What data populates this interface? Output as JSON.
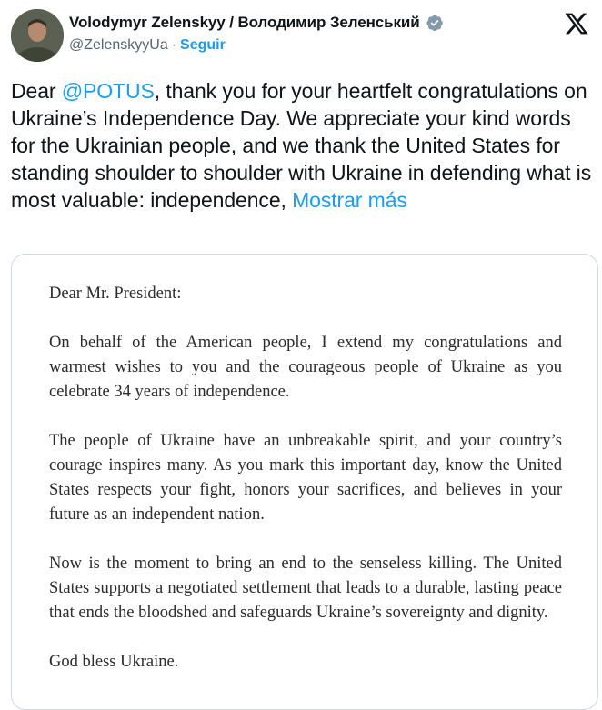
{
  "author": {
    "display_name": "Volodymyr Zelenskyy / Володимир Зеленський",
    "handle": "@ZelenskyyUa",
    "separator": "·",
    "follow_label": "Seguir"
  },
  "tweet": {
    "text_before_mention": "Dear ",
    "mention": "@POTUS",
    "text_after_mention": ", thank you for your heartfelt congratulations on Ukraine’s Independence Day. We appreciate your kind words for the Ukrainian people, and we thank the United States for standing shoulder to shoulder with Ukraine in defending what is most valuable: independence, ",
    "show_more_label": "Mostrar más"
  },
  "letter": {
    "salutation": "Dear Mr. President:",
    "paragraphs": [
      "On behalf of the American people, I extend my congratulations and warmest wishes to you and the courageous people of Ukraine as you celebrate 34 years of independence.",
      "The people of Ukraine have an unbreakable spirit, and your country’s courage inspires many. As you mark this important day, know the United States respects your fight, honors your sacrifices, and believes in your future as an independent nation.",
      "Now is the moment to bring an end to the senseless killing. The United States supports a negotiated settlement that leads to a durable, lasting peace that ends the bloodshed and safeguards Ukraine’s sovereignty and dignity."
    ],
    "closing": "God bless Ukraine."
  },
  "icons": {
    "avatar": "avatar",
    "verified": "verified-badge-icon",
    "logo": "x-logo-icon"
  },
  "colors": {
    "link": "#1d9bf0",
    "text": "#0f1419",
    "secondary": "#536471",
    "verified_badge": "#829aab"
  }
}
